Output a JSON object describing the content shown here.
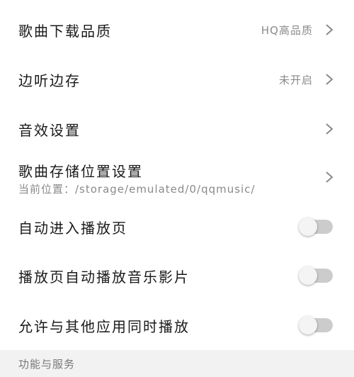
{
  "settings": {
    "download_quality": {
      "label": "歌曲下载品质",
      "value": "HQ高品质"
    },
    "listen_and_save": {
      "label": "边听边存",
      "value": "未开启"
    },
    "sound_effects": {
      "label": "音效设置"
    },
    "storage_location": {
      "label": "歌曲存储位置设置",
      "sub": "当前位置：/storage/emulated/0/qqmusic/"
    },
    "auto_player_page": {
      "label": "自动进入播放页",
      "enabled": false
    },
    "auto_play_mv": {
      "label": "播放页自动播放音乐影片",
      "enabled": false
    },
    "allow_simultaneous": {
      "label": "允许与其他应用同时播放",
      "enabled": false
    }
  },
  "section": {
    "title": "功能与服务"
  },
  "colors": {
    "toggle_off_track": "#cccccc",
    "toggle_knob": "#f4f4f4",
    "secondary_text": "#8a8a8a",
    "section_bg": "#f2f2f2"
  },
  "icons": {
    "chevron": "chevron-right-icon"
  }
}
